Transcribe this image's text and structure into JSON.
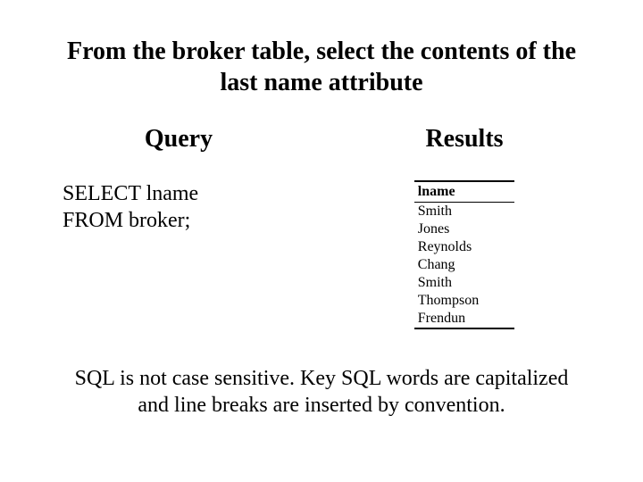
{
  "title": "From the broker table, select the contents of the last name attribute",
  "query": {
    "heading": "Query",
    "line1": "SELECT lname",
    "line2": "FROM broker;"
  },
  "results": {
    "heading": "Results",
    "header": "lname",
    "rows": [
      "Smith",
      "Jones",
      "Reynolds",
      "Chang",
      "Smith",
      "Thompson",
      "Frendun"
    ]
  },
  "footnote": "SQL is not case sensitive.  Key SQL words are capitalized and line breaks are inserted by convention."
}
